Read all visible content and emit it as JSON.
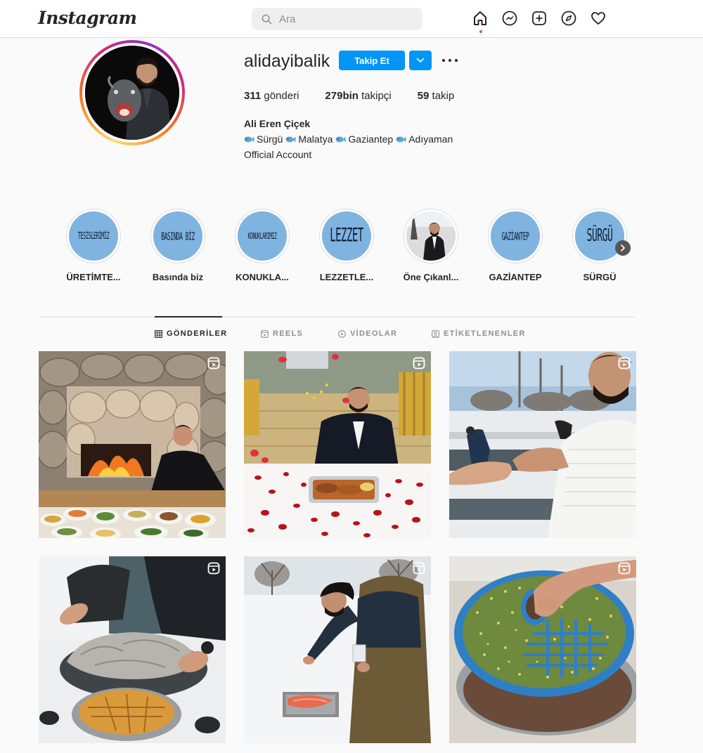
{
  "nav": {
    "logo": "Instagram",
    "search_placeholder": "Ara",
    "icons": [
      "home-icon",
      "messenger-icon",
      "new-post-icon",
      "explore-icon",
      "activity-heart-icon"
    ]
  },
  "profile": {
    "username": "alidayibalik",
    "follow_label": "Takip Et",
    "stats": [
      {
        "value": "311",
        "label": "gönderi"
      },
      {
        "value": "279bin",
        "label": "takipçi"
      },
      {
        "value": "59",
        "label": "takip"
      }
    ],
    "full_name": "Ali Eren Çiçek",
    "bio_places": [
      "Sürgü",
      "Malatya",
      "Gaziantep",
      "Adıyaman"
    ],
    "bio_line2": "Official Account"
  },
  "highlights": [
    {
      "label": "ÜRETİMTE...",
      "cover_text": "TESİSLERİMİZ",
      "kind": "text"
    },
    {
      "label": "Basında biz",
      "cover_text": "BASINDA BİZ",
      "kind": "text"
    },
    {
      "label": "KONUKLA...",
      "cover_text": "KONUKLARIMIZ",
      "kind": "text"
    },
    {
      "label": "LEZZETLE...",
      "cover_text": "LEZZET",
      "kind": "text"
    },
    {
      "label": "Öne Çıkanl...",
      "cover_text": "",
      "kind": "photo"
    },
    {
      "label": "GAZİANTEP",
      "cover_text": "GAZİANTEP",
      "kind": "text"
    },
    {
      "label": "SÜRGÜ",
      "cover_text": "SÜRGÜ",
      "kind": "text"
    }
  ],
  "tabs": [
    {
      "label": "GÖNDERİLER",
      "icon": "grid-icon",
      "active": true
    },
    {
      "label": "REELS",
      "icon": "reels-icon",
      "active": false
    },
    {
      "label": "VİDEOLAR",
      "icon": "video-play-icon",
      "active": false
    },
    {
      "label": "ETİKETLENENLER",
      "icon": "tagged-icon",
      "active": false
    }
  ],
  "posts": [
    {
      "scene": "stone-oven-feast",
      "type": "reel"
    },
    {
      "scene": "rose-petal-table",
      "type": "reel"
    },
    {
      "scene": "fish-farm-pools",
      "type": "reel"
    },
    {
      "scene": "snow-fish-bake",
      "type": "reel"
    },
    {
      "scene": "snow-salmon-tray",
      "type": "reel"
    },
    {
      "scene": "fish-eggs-sieve",
      "type": "reel"
    }
  ],
  "colors": {
    "accent": "#0095f6",
    "text": "#262626",
    "muted": "#8e8e8e",
    "border": "#dbdbdb",
    "highlight_cover": "#7fb3e0",
    "notification_dot": "#ed4956"
  }
}
